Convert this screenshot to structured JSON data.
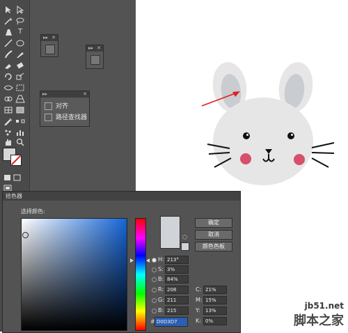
{
  "floating_panels": {
    "align_label": "对齐",
    "pathfinder_label": "路径查找器"
  },
  "color_picker": {
    "title": "拾色器",
    "select_color_label": "选择颜色:",
    "ok_label": "确定",
    "cancel_label": "取消",
    "swatches_label": "颜色色板",
    "fields": {
      "h": {
        "label": "H:",
        "value": "213°"
      },
      "s": {
        "label": "S:",
        "value": "3%"
      },
      "b": {
        "label": "B:",
        "value": "84%"
      },
      "r": {
        "label": "R:",
        "value": "208"
      },
      "g": {
        "label": "G:",
        "value": "211"
      },
      "bl": {
        "label": "B:",
        "value": "215"
      },
      "c": {
        "label": "C:",
        "value": "21%"
      },
      "m": {
        "label": "M:",
        "value": "15%"
      },
      "y": {
        "label": "Y:",
        "value": "13%"
      },
      "k": {
        "label": "K:",
        "value": "0%"
      }
    },
    "hex_symbol": "#",
    "hex": "D0D3D7",
    "preview_color": "#d0d3d7"
  },
  "artwork": {
    "head_color": "#e6e6e6",
    "inner_ear_color": "#c9ccd0",
    "cheek_color": "#d6506b",
    "arrow_color": "#e02020"
  },
  "watermark": {
    "site": "jb51.net",
    "name": "脚本之家"
  }
}
